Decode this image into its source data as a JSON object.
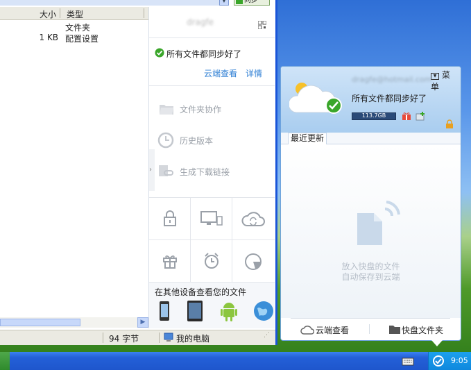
{
  "explorer": {
    "columns": {
      "size": "大小",
      "type": "类型"
    },
    "rows": [
      {
        "size": "",
        "type": "文件夹"
      },
      {
        "size": "1 KB",
        "type": "配置设置"
      }
    ],
    "status": {
      "bytes": "94 字节",
      "location": "我的电脑"
    },
    "top_button": "同步"
  },
  "panel": {
    "account": "dragfe",
    "sync_status": "所有文件都同步好了",
    "cloud_view": "云端查看",
    "details": "详情",
    "features": [
      "文件夹协作",
      "历史版本",
      "生成下载链接"
    ],
    "other_devices": "在其他设备查看您的文件"
  },
  "popup": {
    "menu": "菜单",
    "email": "dragfe@hotmail.com",
    "sync_status": "所有文件都同步好了",
    "storage": "113.7GB",
    "tab_recent": "最近更新",
    "empty_line1": "放入快盘的文件",
    "empty_line2": "自动保存到云端",
    "cloud_view": "云端查看",
    "folder": "快盘文件夹"
  },
  "taskbar": {
    "time": "9:05"
  },
  "colors": {
    "link": "#2f7fd4",
    "accent_green": "#3aa62a",
    "taskbar_blue": "#2460d8"
  }
}
